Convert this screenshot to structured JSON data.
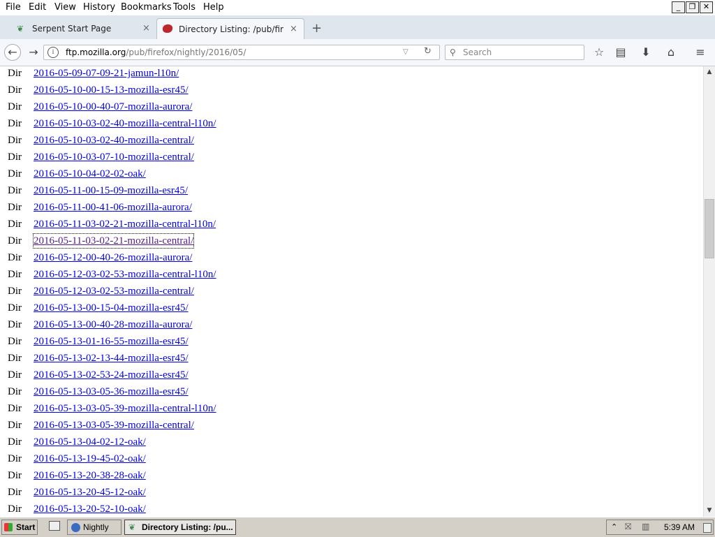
{
  "menu": [
    "File",
    "Edit",
    "View",
    "History",
    "Bookmarks",
    "Tools",
    "Help"
  ],
  "window_controls": {
    "minimize": "_",
    "restore": "❐",
    "close": "✕"
  },
  "tabs": [
    {
      "label": "Serpent Start Page",
      "icon": "serpent-icon",
      "close": "×"
    },
    {
      "label": "Directory Listing: /pub/firefo",
      "icon": "nightly-icon",
      "close": "×",
      "active": true
    }
  ],
  "new_tab": "+",
  "navbar": {
    "url_host": "ftp.mozilla.org",
    "url_path": "/pub/firefox/nightly/2016/05/",
    "search_placeholder": "Search"
  },
  "listing": {
    "type_label": "Dir",
    "entries": [
      "2016-05-09-07-09-21-jamun-l10n/",
      "2016-05-10-00-15-13-mozilla-esr45/",
      "2016-05-10-00-40-07-mozilla-aurora/",
      "2016-05-10-03-02-40-mozilla-central-l10n/",
      "2016-05-10-03-02-40-mozilla-central/",
      "2016-05-10-03-07-10-mozilla-central/",
      "2016-05-10-04-02-02-oak/",
      "2016-05-11-00-15-09-mozilla-esr45/",
      "2016-05-11-00-41-06-mozilla-aurora/",
      "2016-05-11-03-02-21-mozilla-central-l10n/",
      "2016-05-11-03-02-21-mozilla-central/",
      "2016-05-12-00-40-26-mozilla-aurora/",
      "2016-05-12-03-02-53-mozilla-central-l10n/",
      "2016-05-12-03-02-53-mozilla-central/",
      "2016-05-13-00-15-04-mozilla-esr45/",
      "2016-05-13-00-40-28-mozilla-aurora/",
      "2016-05-13-01-16-55-mozilla-esr45/",
      "2016-05-13-02-13-44-mozilla-esr45/",
      "2016-05-13-02-53-24-mozilla-esr45/",
      "2016-05-13-03-05-36-mozilla-esr45/",
      "2016-05-13-03-05-39-mozilla-central-l10n/",
      "2016-05-13-03-05-39-mozilla-central/",
      "2016-05-13-04-02-12-oak/",
      "2016-05-13-19-45-02-oak/",
      "2016-05-13-20-38-28-oak/",
      "2016-05-13-20-45-12-oak/",
      "2016-05-13-20-52-10-oak/"
    ],
    "focused_entry": "2016-05-11-03-02-21-mozilla-central/"
  },
  "taskbar": {
    "start": "Start",
    "buttons": [
      "Nightly",
      "Directory Listing: /pu..."
    ],
    "clock": "5:39 AM"
  }
}
